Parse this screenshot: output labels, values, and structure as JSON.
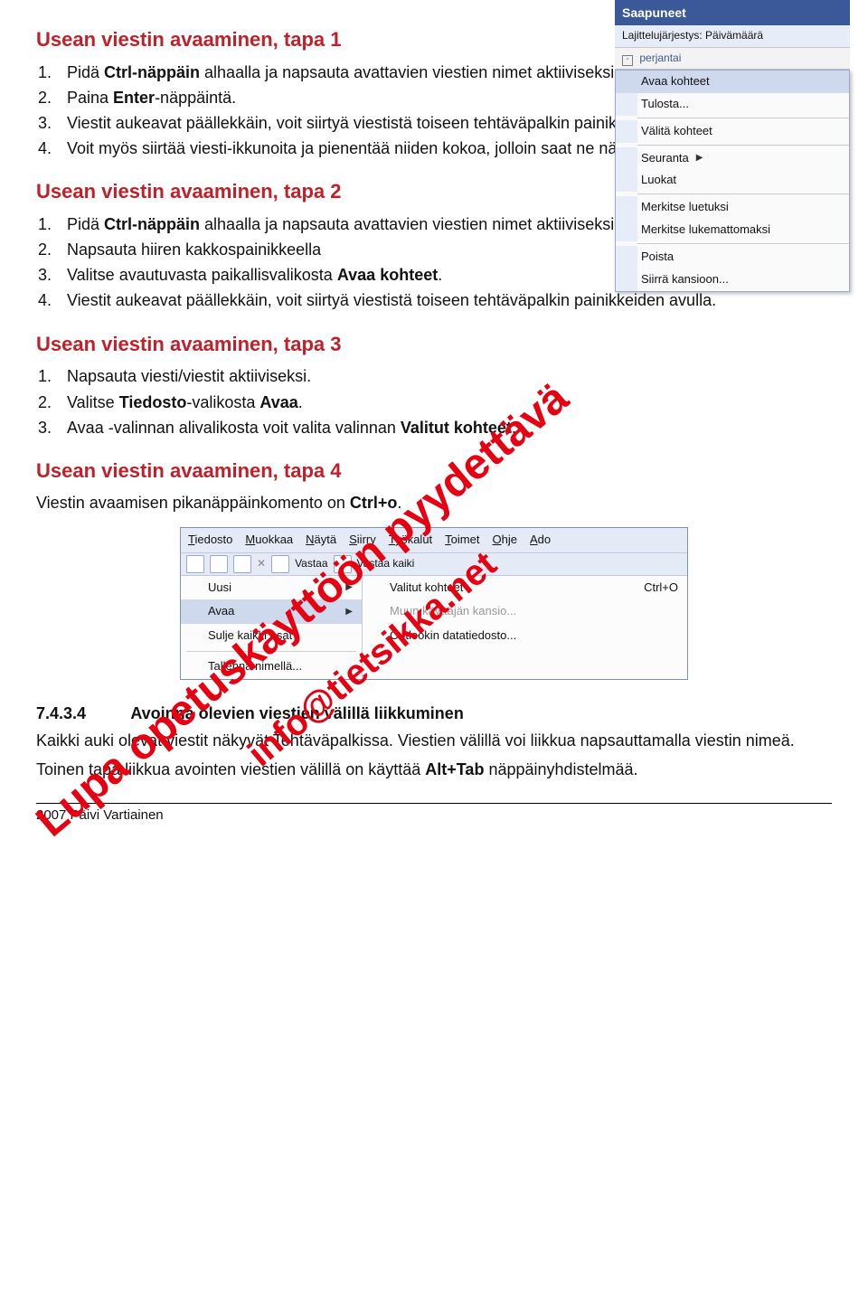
{
  "sections": {
    "s1": {
      "title": "Usean viestin avaaminen, tapa 1",
      "items": [
        "Pidä Ctrl-näppäin alhaalla ja napsauta avattavien viestien nimet aktiiviseksi.",
        "Paina Enter-näppäintä.",
        "Viestit aukeavat päällekkäin, voit siirtyä viestistä toiseen tehtäväpalkin painikkeiden avulla.",
        "Voit myös siirtää viesti-ikkunoita ja pienentää niiden kokoa, jolloin saat ne näkyviin yhtä aikaa."
      ]
    },
    "s2": {
      "title": "Usean viestin avaaminen, tapa 2",
      "items": [
        "Pidä Ctrl-näppäin alhaalla ja napsauta avattavien viestien nimet aktiiviseksi.",
        "Napsauta hiiren kakkospainikkeella",
        "Valitse avautuvasta paikallisvalikosta Avaa kohteet.",
        "Viestit aukeavat päällekkäin, voit siirtyä viestistä toiseen tehtäväpalkin painikkeiden avulla."
      ]
    },
    "s3": {
      "title": "Usean viestin avaaminen, tapa 3",
      "items": [
        "Napsauta viesti/viestit aktiiviseksi.",
        "Valitse Tiedosto-valikosta Avaa.",
        "Avaa -valinnan alivalikosta voit valita valinnan Valitut kohteet."
      ]
    },
    "s4": {
      "title": "Usean viestin avaaminen, tapa 4",
      "text": "Viestin avaamisen pikanäppäinkomento on Ctrl+o."
    },
    "sub": {
      "num": "7.4.3.4",
      "title": "Avoinna olevien viestien välillä liikkuminen",
      "p1": "Kaikki auki olevat viestit näkyvät Tehtäväpalkissa. Viestien välillä voi liikkua napsauttamalla viestin nimeä.",
      "p2": "Toinen tapa liikkua avointen viestien välillä on käyttää Alt+Tab näppäinyhdistelmää."
    }
  },
  "outlook_pane": {
    "title": "Saapuneet",
    "sort": "Lajittelujärjestys: Päivämäärä",
    "day": "perjantai",
    "ctx": [
      "Avaa kohteet",
      "Tulosta...",
      "Välitä kohteet",
      "Seuranta",
      "Luokat",
      "Merkitse luetuksi",
      "Merkitse lukemattomaksi",
      "Poista",
      "Siirrä kansioon..."
    ]
  },
  "filemenu": {
    "menubar": [
      "Tiedosto",
      "Muokkaa",
      "Näytä",
      "Siirry",
      "Työkalut",
      "Toimet",
      "Ohje",
      "Ado"
    ],
    "toolbar": [
      "Vastaa",
      "Vastaa kaiki"
    ],
    "left": [
      {
        "label": "Uusi",
        "sub": true
      },
      {
        "label": "Avaa",
        "sub": true,
        "hover": true
      },
      {
        "label": "Sulje kaikki osat"
      },
      {
        "label": "Tallenna nimellä..."
      }
    ],
    "right": [
      {
        "label": "Valitut kohteet",
        "accel": "Ctrl+O"
      },
      {
        "label": "Muun käyttäjän kansio...",
        "disabled": true
      },
      {
        "label": "Outlookin datatiedosto..."
      }
    ]
  },
  "watermarks": {
    "big": "Lupa opetuskäyttöön pyydettävä",
    "small": "info@tietsikka.net"
  },
  "footer": "2007 Päivi Vartiainen"
}
